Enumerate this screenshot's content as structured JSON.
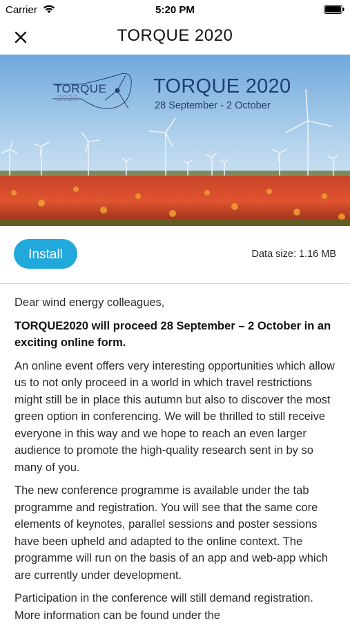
{
  "status_bar": {
    "carrier": "Carrier",
    "time": "5:20 PM",
    "icons": [
      "wifi-icon",
      "battery-icon"
    ]
  },
  "nav": {
    "title": "TORQUE 2020",
    "close_icon": "close-icon"
  },
  "banner": {
    "title": "TORQUE 2020",
    "dates": "28 September - 2 October",
    "logo_text": "TORQUE",
    "logo_year": "2020"
  },
  "install": {
    "button_label": "Install",
    "data_size": "Data size: 1.16 MB",
    "accent_color": "#22a9dc"
  },
  "content": {
    "greeting": "Dear wind energy colleagues,",
    "headline": "TORQUE2020 will proceed 28 September – 2 October in an exciting online form.",
    "paragraph_1": "An online event offers very interesting opportunities which allow us to not only proceed in a world in which travel restrictions might still be in place this autumn but also to discover the most green option in conferencing. We will be thrilled to still receive everyone in this way and we hope to reach an even larger audience to promote the high-quality research sent in by so many of you.",
    "paragraph_2": "The new conference programme is available under the tab programme and registration. You will see that the same core elements of keynotes, parallel sessions and poster sessions have been upheld and adapted to the online context. The programme will run on the basis of an app and web-app which are currently under development.",
    "paragraph_3": "Participation in the conference will still demand registration. More information can be found under the"
  }
}
